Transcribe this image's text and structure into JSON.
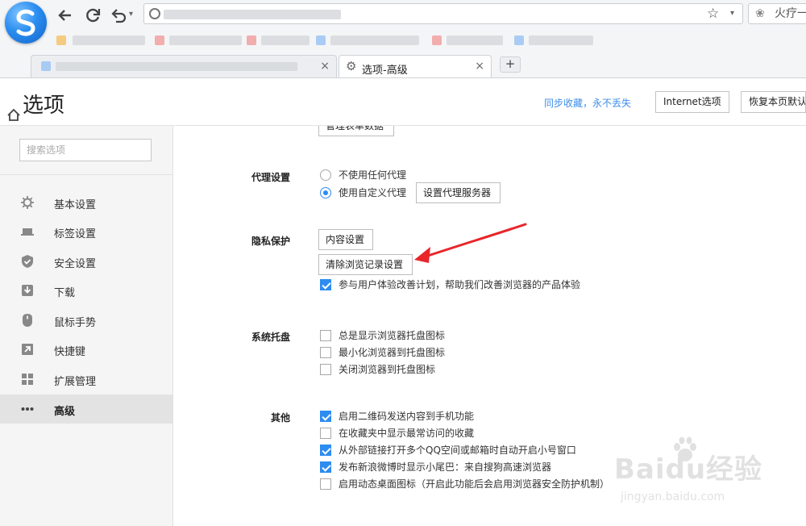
{
  "browser": {
    "search_box_text": "火疗一",
    "tabs": [
      {
        "label": "",
        "active": false
      },
      {
        "label": "选项-高级",
        "active": true
      }
    ],
    "new_tab_label": "+",
    "close_glyph": "×"
  },
  "header": {
    "title": "选项",
    "sync_link": "同步收藏，永不丢失",
    "internet_options_button": "Internet选项",
    "restore_button": "恢复本页默认"
  },
  "sidebar": {
    "search_placeholder": "搜索选项",
    "items": [
      {
        "label": "基本设置",
        "icon": "gear-icon",
        "active": false
      },
      {
        "label": "标签设置",
        "icon": "tab-icon",
        "active": false
      },
      {
        "label": "安全设置",
        "icon": "shield-check-icon",
        "active": false
      },
      {
        "label": "下载",
        "icon": "download-icon",
        "active": false
      },
      {
        "label": "鼠标手势",
        "icon": "mouse-icon",
        "active": false
      },
      {
        "label": "快捷键",
        "icon": "shortcut-arrow-icon",
        "active": false
      },
      {
        "label": "扩展管理",
        "icon": "extensions-icon",
        "active": false
      },
      {
        "label": "高级",
        "icon": "more-dots-icon",
        "active": true
      }
    ]
  },
  "main": {
    "top_partial_button": "管理表单数据",
    "proxy": {
      "label": "代理设置",
      "options": [
        {
          "label": "不使用任何代理",
          "checked": false
        },
        {
          "label": "使用自定义代理",
          "checked": true
        }
      ],
      "server_button": "设置代理服务器"
    },
    "privacy": {
      "label": "隐私保护",
      "content_button": "内容设置",
      "clear_button": "清除浏览记录设置",
      "experience": {
        "label": "参与用户体验改善计划，帮助我们改善浏览器的产品体验",
        "checked": true
      }
    },
    "tray": {
      "label": "系统托盘",
      "options": [
        {
          "label": "总是显示浏览器托盘图标",
          "checked": false
        },
        {
          "label": "最小化浏览器到托盘图标",
          "checked": false
        },
        {
          "label": "关闭浏览器到托盘图标",
          "checked": false
        }
      ]
    },
    "other": {
      "label": "其他",
      "options": [
        {
          "label": "启用二维码发送内容到手机功能",
          "checked": true
        },
        {
          "label": "在收藏夹中显示最常访问的收藏",
          "checked": false
        },
        {
          "label": "从外部链接打开多个QQ空间或邮箱时自动开启小号窗口",
          "checked": true
        },
        {
          "label": "发布新浪微博时显示小尾巴：来自搜狗高速浏览器",
          "checked": true
        },
        {
          "label": "启用动态桌面图标（开启此功能后会启用浏览器安全防护机制）",
          "checked": false
        }
      ]
    }
  },
  "watermark": {
    "brand": "Baidu经验",
    "url": "jingyan.baidu.com"
  },
  "colors": {
    "accent": "#2d8cf0",
    "link": "#3f8ee8",
    "arrow": "#e8262a"
  }
}
